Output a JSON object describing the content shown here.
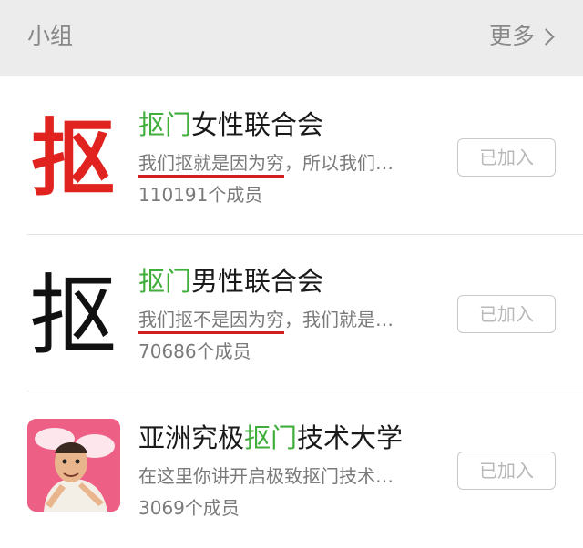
{
  "header": {
    "title": "小组",
    "more_label": "更多"
  },
  "groups": [
    {
      "avatar_char": "抠",
      "name_highlight": "抠门",
      "name_rest": "女性联合会",
      "desc_underlined": "我们抠就是因为穷",
      "desc_rest": "，所以我们…",
      "members": "110191个成员",
      "button": "已加入"
    },
    {
      "avatar_char": "抠",
      "name_highlight": "抠门",
      "name_rest": "男性联合会",
      "desc_underlined": "我们抠不是因为穷",
      "desc_rest": "，我们就是…",
      "members": "70686个成员",
      "button": "已加入"
    },
    {
      "name_prefix": "亚洲究极",
      "name_highlight": "抠门",
      "name_rest": "技术大学",
      "desc": "在这里你讲开启极致抠门技术…",
      "members": "3069个成员",
      "button": "已加入"
    }
  ],
  "colors": {
    "highlight_green": "#3fae3b",
    "underline_red": "#d11f1f",
    "avatar_red": "#e0231f",
    "header_bg": "#ececec"
  }
}
